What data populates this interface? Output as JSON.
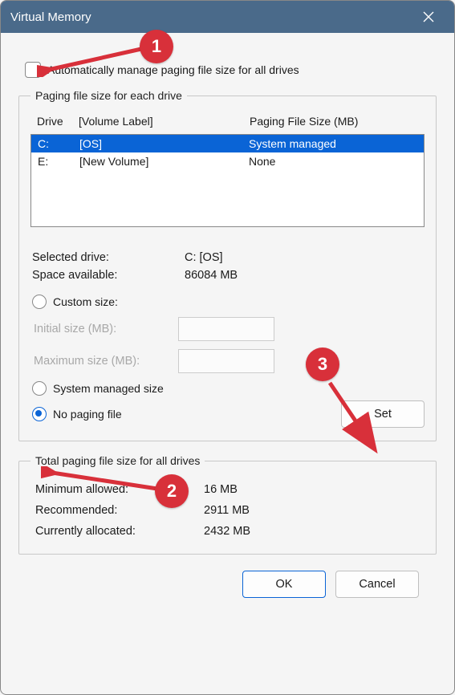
{
  "window": {
    "title": "Virtual Memory"
  },
  "autoManage": {
    "label": "Automatically manage paging file size for all drives",
    "checked": false
  },
  "driveGroup": {
    "legend": "Paging file size for each drive",
    "headers": {
      "drive": "Drive",
      "label": "[Volume Label]",
      "size": "Paging File Size (MB)"
    },
    "rows": [
      {
        "drive": "C:",
        "label": "[OS]",
        "size": "System managed",
        "selected": true
      },
      {
        "drive": "E:",
        "label": "[New Volume]",
        "size": "None",
        "selected": false
      }
    ],
    "selectedDrive": {
      "label": "Selected drive:",
      "value": "C:  [OS]"
    },
    "spaceAvailable": {
      "label": "Space available:",
      "value": "86084 MB"
    },
    "options": {
      "custom": "Custom size:",
      "initial": "Initial size (MB):",
      "maximum": "Maximum size (MB):",
      "systemManaged": "System managed size",
      "noPaging": "No paging file",
      "selected": "noPaging"
    },
    "setButton": "Set"
  },
  "totalsGroup": {
    "legend": "Total paging file size for all drives",
    "minimum": {
      "label": "Minimum allowed:",
      "value": "16 MB"
    },
    "recommended": {
      "label": "Recommended:",
      "value": "2911 MB"
    },
    "allocated": {
      "label": "Currently allocated:",
      "value": "2432 MB"
    }
  },
  "footer": {
    "ok": "OK",
    "cancel": "Cancel"
  },
  "annotations": {
    "1": "1",
    "2": "2",
    "3": "3"
  }
}
